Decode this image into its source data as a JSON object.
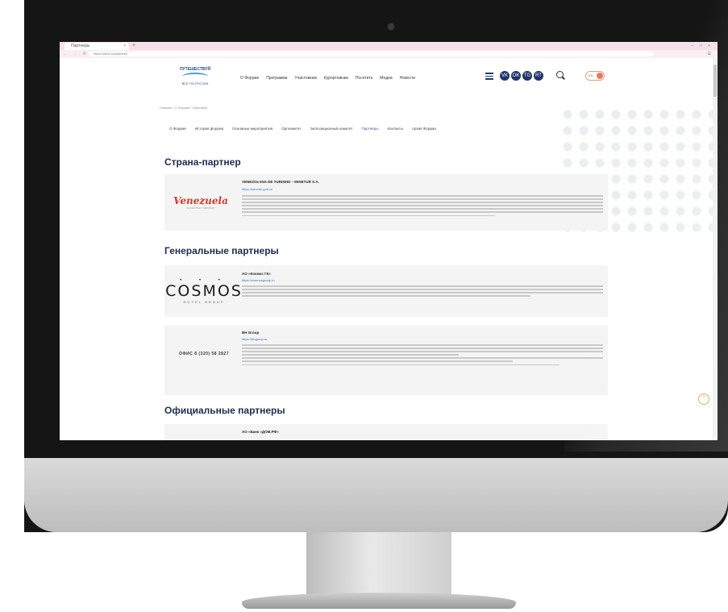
{
  "browser": {
    "tab_title": "Партнеры",
    "tab_close": "×",
    "new_tab": "+",
    "window_controls": "– □ ×",
    "nav_buttons": "← → ⟳",
    "url": "https://vdnh.ru/partners/",
    "profile": "☰"
  },
  "site": {
    "logo_top": "ПУТЕШЕСТВУЙ",
    "logo_bottom": "ВСЕ ПО-РУССКИ",
    "nav": [
      "О Форуме",
      "Программа",
      "Участникам",
      "Курортникам",
      "Посетить",
      "Медиа",
      "Новости"
    ],
    "social": [
      "VK",
      "OK",
      "TG",
      "RT"
    ],
    "lang": "EN",
    "breadcrumb": "Главная / О Форуме / Партнеры",
    "subnav": [
      "О Форуме",
      "История форума",
      "Основные мероприятия",
      "Оргкомитет",
      "Экспозиционный комитет",
      "Партнеры",
      "Контакты",
      "Архив Форума"
    ],
    "subnav_active_index": 5
  },
  "sections": {
    "country_partner": "Страна-партнер",
    "general_partners": "Генеральные партнеры",
    "official_partners": "Официальные партнеры"
  },
  "partners": {
    "venezuela": {
      "logo": "Venezuela",
      "logo_sub": "TU DESTINO TURÍSTICO",
      "title": "VENEZOLANA DE TURISMO - VENETUR S.A.",
      "link": "https://venetur.gob.ve"
    },
    "cosmos": {
      "logo": "COSMOS",
      "logo_sub": "HOTEL GROUP",
      "title": "АО «Космос ГК»",
      "link": "https://cosmosgroup.ru"
    },
    "bh": {
      "logo": "ОФИС 8 (320) 58 2827",
      "title": "BH Group",
      "link": "https://bhgroup.ru"
    },
    "domrf": {
      "title": "АО «Банк «ДОМ.РФ»"
    }
  },
  "scroll_top_icon": "^"
}
